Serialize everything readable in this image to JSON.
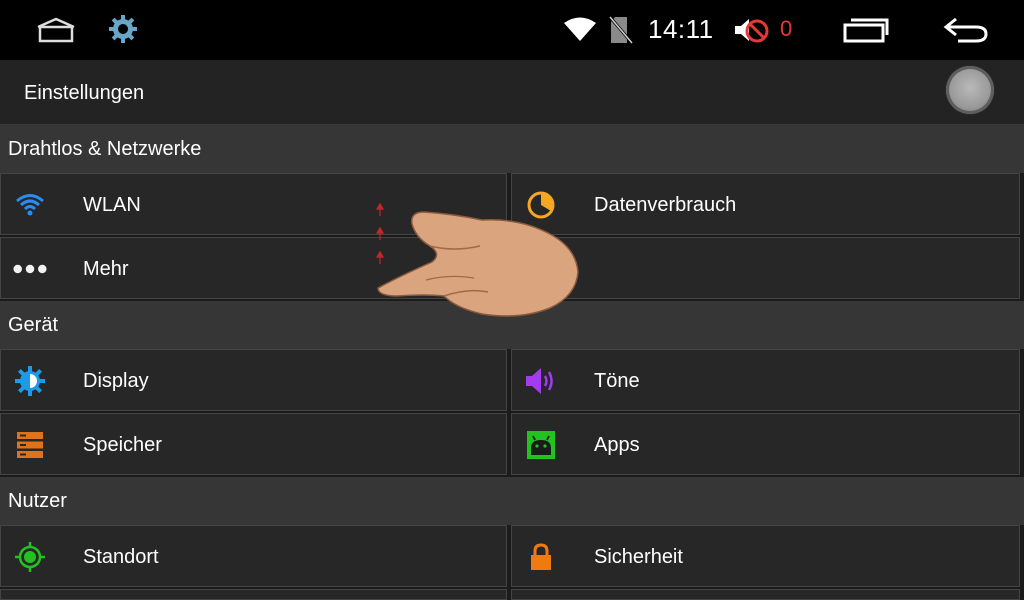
{
  "statusbar": {
    "time": "14:11",
    "notification_count": "0",
    "icons": [
      "home-icon",
      "settings-gear-icon",
      "wifi-signal-icon",
      "no-sim-icon",
      "volume-muted-icon",
      "recent-apps-icon",
      "back-arrow-icon"
    ]
  },
  "header": {
    "title": "Einstellungen"
  },
  "sections": [
    {
      "title": "Drahtlos & Netzwerke",
      "items": [
        {
          "label": "WLAN",
          "icon": "wifi-icon"
        },
        {
          "label": "Datenverbrauch",
          "icon": "data-usage-icon"
        },
        {
          "label": "Mehr",
          "icon": "more-dots-icon"
        }
      ]
    },
    {
      "title": "Gerät",
      "items": [
        {
          "label": "Display",
          "icon": "display-brightness-icon"
        },
        {
          "label": "Töne",
          "icon": "sound-icon"
        },
        {
          "label": "Speicher",
          "icon": "storage-icon"
        },
        {
          "label": "Apps",
          "icon": "apps-android-icon"
        }
      ]
    },
    {
      "title": "Nutzer",
      "items": [
        {
          "label": "Standort",
          "icon": "location-icon"
        },
        {
          "label": "Sicherheit",
          "icon": "lock-icon"
        }
      ]
    }
  ],
  "colors": {
    "wifi": "#2a8cf0",
    "data_usage": "#f5a623",
    "display": "#1e9be8",
    "sound": "#a33cf0",
    "storage": "#e0731a",
    "apps": "#22c321",
    "location": "#22c321",
    "lock": "#f07a10",
    "alert": "#e53935"
  }
}
